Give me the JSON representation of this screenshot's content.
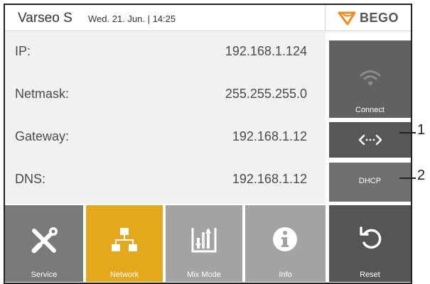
{
  "header": {
    "app_title": "Varseo S",
    "datetime": "Wed. 21. Jun. | 14:25",
    "logo_text": "BEGO"
  },
  "network": {
    "rows": [
      {
        "label": "IP:",
        "value": "192.168.1.124"
      },
      {
        "label": "Netmask:",
        "value": "255.255.255.0"
      },
      {
        "label": "Gateway:",
        "value": "192.168.1.12"
      },
      {
        "label": "DNS:",
        "value": "192.168.1.12"
      }
    ]
  },
  "side_buttons": {
    "connect_label": "Connect",
    "dhcp_label": "DHCP",
    "reset_label": "Reset"
  },
  "bottom_nav": {
    "tabs": [
      {
        "label": "Service",
        "icon": "tools-icon",
        "color": "#7a7a7a"
      },
      {
        "label": "Network",
        "icon": "network-icon",
        "color": "#e4a81c",
        "active": true
      },
      {
        "label": "Mix Mode",
        "icon": "mix-mode-icon",
        "color": "#a3a3a3"
      },
      {
        "label": "Info",
        "icon": "info-icon",
        "color": "#a3a3a3"
      }
    ]
  },
  "callouts": {
    "one": "1",
    "two": "2"
  },
  "colors": {
    "accent": "#e4a81c",
    "logo_orange": "#f18a1e",
    "dark_button": "#575757"
  }
}
